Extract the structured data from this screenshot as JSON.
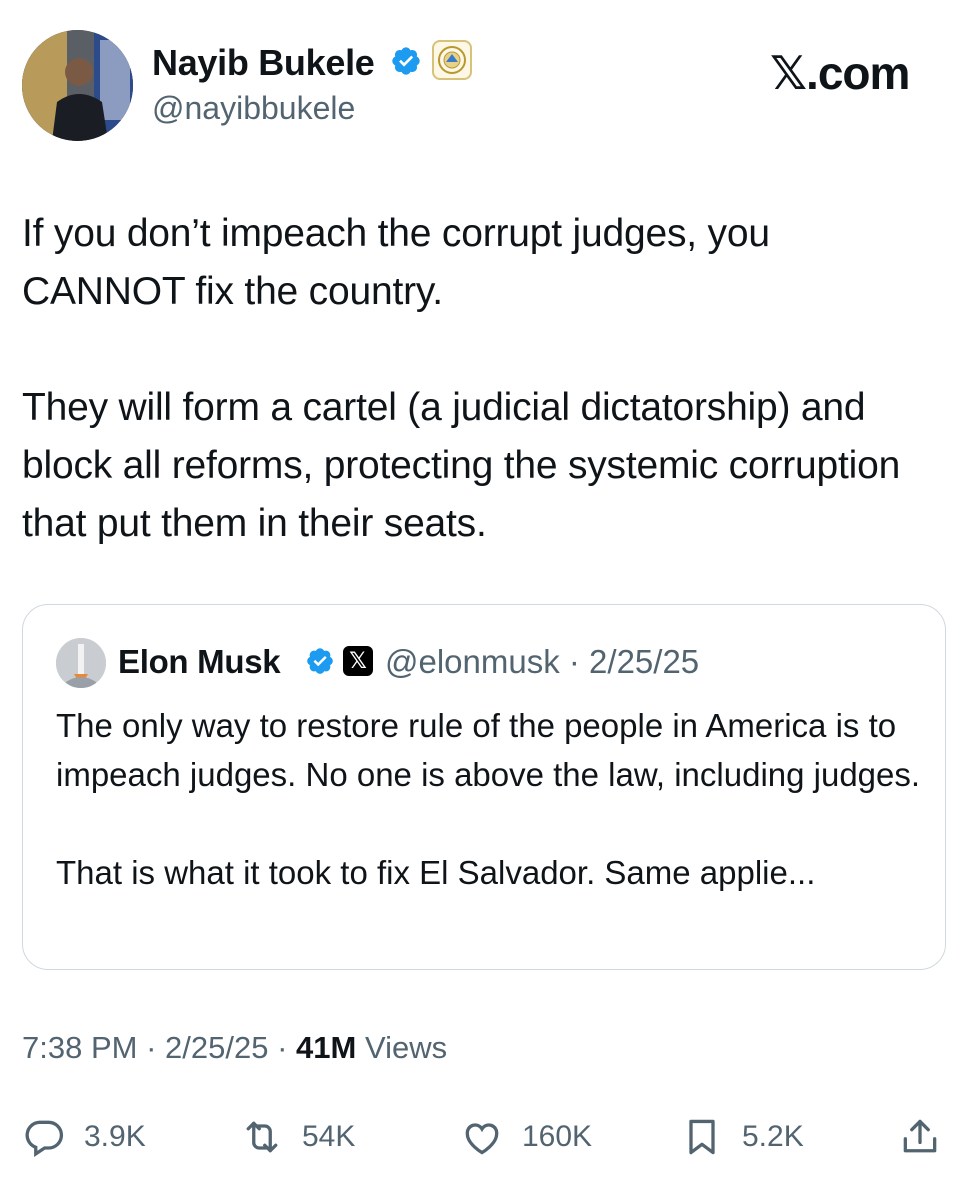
{
  "author": {
    "display_name": "Nayib Bukele",
    "handle": "@nayibbukele",
    "verified_color": "#1d9bf0"
  },
  "brand": "𝕏.com",
  "tweet": {
    "text": "If you don’t impeach the corrupt judges, you CANNOT fix the country.\n\nThey will form a cartel (a judicial dictatorship) and block all reforms, protecting the systemic corruption that put them in their seats."
  },
  "quote": {
    "display_name": "Elon Musk",
    "x_badge": "𝕏",
    "meta": "@elonmusk · 2/25/25",
    "text": "The only way to restore rule of the people in America is to impeach judges. No one is above the law, including judges.\n\nThat is what it took to fix El Salvador. Same applie..."
  },
  "meta": {
    "time": "7:38 PM",
    "date": "2/25/25",
    "views_count": "41M",
    "views_label": "Views",
    "sep": " · "
  },
  "actions": {
    "replies": "3.9K",
    "reposts": "54K",
    "likes": "160K",
    "bookmarks": "5.2K"
  },
  "icons": [
    "verified-icon",
    "government-seal-icon",
    "x-logo-icon",
    "reply-icon",
    "repost-icon",
    "like-icon",
    "bookmark-icon",
    "share-icon"
  ]
}
